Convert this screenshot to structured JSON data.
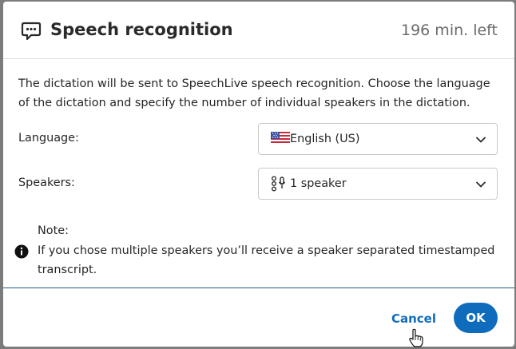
{
  "dialog": {
    "title": "Speech recognition",
    "time_left": "196 min. left",
    "header_icon": "speech-bubble-icon",
    "description": "The dictation will be sent to SpeechLive speech recognition. Choose the language of the dictation and specify the number of individual speakers in the dictation."
  },
  "language": {
    "label": "Language:",
    "value": "English (US)",
    "icon": "us-flag-icon"
  },
  "speakers": {
    "label": "Speakers:",
    "value": "1 speaker",
    "icon": "speaker-mic-icon"
  },
  "note": {
    "title": "Note:",
    "text": "If you chose multiple speakers you’ll receive a speaker separated timestamped transcript.",
    "icon": "info-icon"
  },
  "footer": {
    "cancel_label": "Cancel",
    "ok_label": "OK"
  },
  "colors": {
    "accent": "#0f6cbd",
    "backdrop": "#7c7c7c"
  }
}
